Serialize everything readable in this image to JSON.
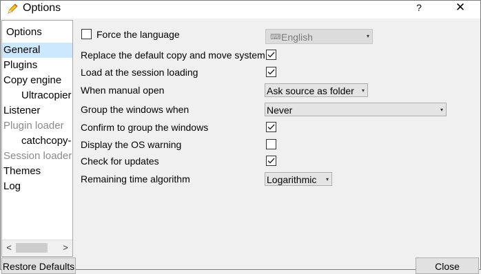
{
  "window": {
    "title": "Options",
    "help_label": "?",
    "close_label": "✕"
  },
  "sidebar": {
    "header": "Options",
    "items": [
      {
        "label": "General",
        "state": "selected"
      },
      {
        "label": "Plugins",
        "state": "normal"
      },
      {
        "label": "Copy engine",
        "state": "normal"
      },
      {
        "label": "Ultracopier",
        "state": "normal"
      },
      {
        "label": "Listener",
        "state": "normal"
      },
      {
        "label": "Plugin loader",
        "state": "disabled"
      },
      {
        "label": "catchcopy-",
        "state": "normal"
      },
      {
        "label": "Session loader",
        "state": "disabled"
      },
      {
        "label": "Themes",
        "state": "normal"
      },
      {
        "label": "Log",
        "state": "normal"
      }
    ],
    "scroll_left": "<",
    "scroll_right": ">"
  },
  "settings": {
    "force_language": {
      "label": "Force the language",
      "checked": false,
      "value": "English"
    },
    "replace_default": {
      "label": "Replace the default copy and move system",
      "checked": true
    },
    "load_at_session": {
      "label": "Load at the session loading",
      "checked": true
    },
    "manual_open": {
      "label": "When manual open",
      "value": "Ask source as folder"
    },
    "group_windows": {
      "label": "Group the windows when",
      "value": "Never"
    },
    "confirm_group": {
      "label": "Confirm to group the windows",
      "checked": true
    },
    "os_warning": {
      "label": "Display the OS warning",
      "checked": false
    },
    "check_updates": {
      "label": "Check for updates",
      "checked": true
    },
    "remaining_time": {
      "label": "Remaining time algorithm",
      "value": "Logarithmic"
    }
  },
  "footer": {
    "restore_label": "Restore Defaults",
    "close_label": "Close"
  },
  "icons": {
    "app": "pencil-icon",
    "language": "keyboard-icon",
    "dropdown": "chevron-down-icon"
  },
  "colors": {
    "selection": "#cce8ff",
    "disabled_text": "#8a8a8a",
    "title_bar": "#ffffff"
  }
}
